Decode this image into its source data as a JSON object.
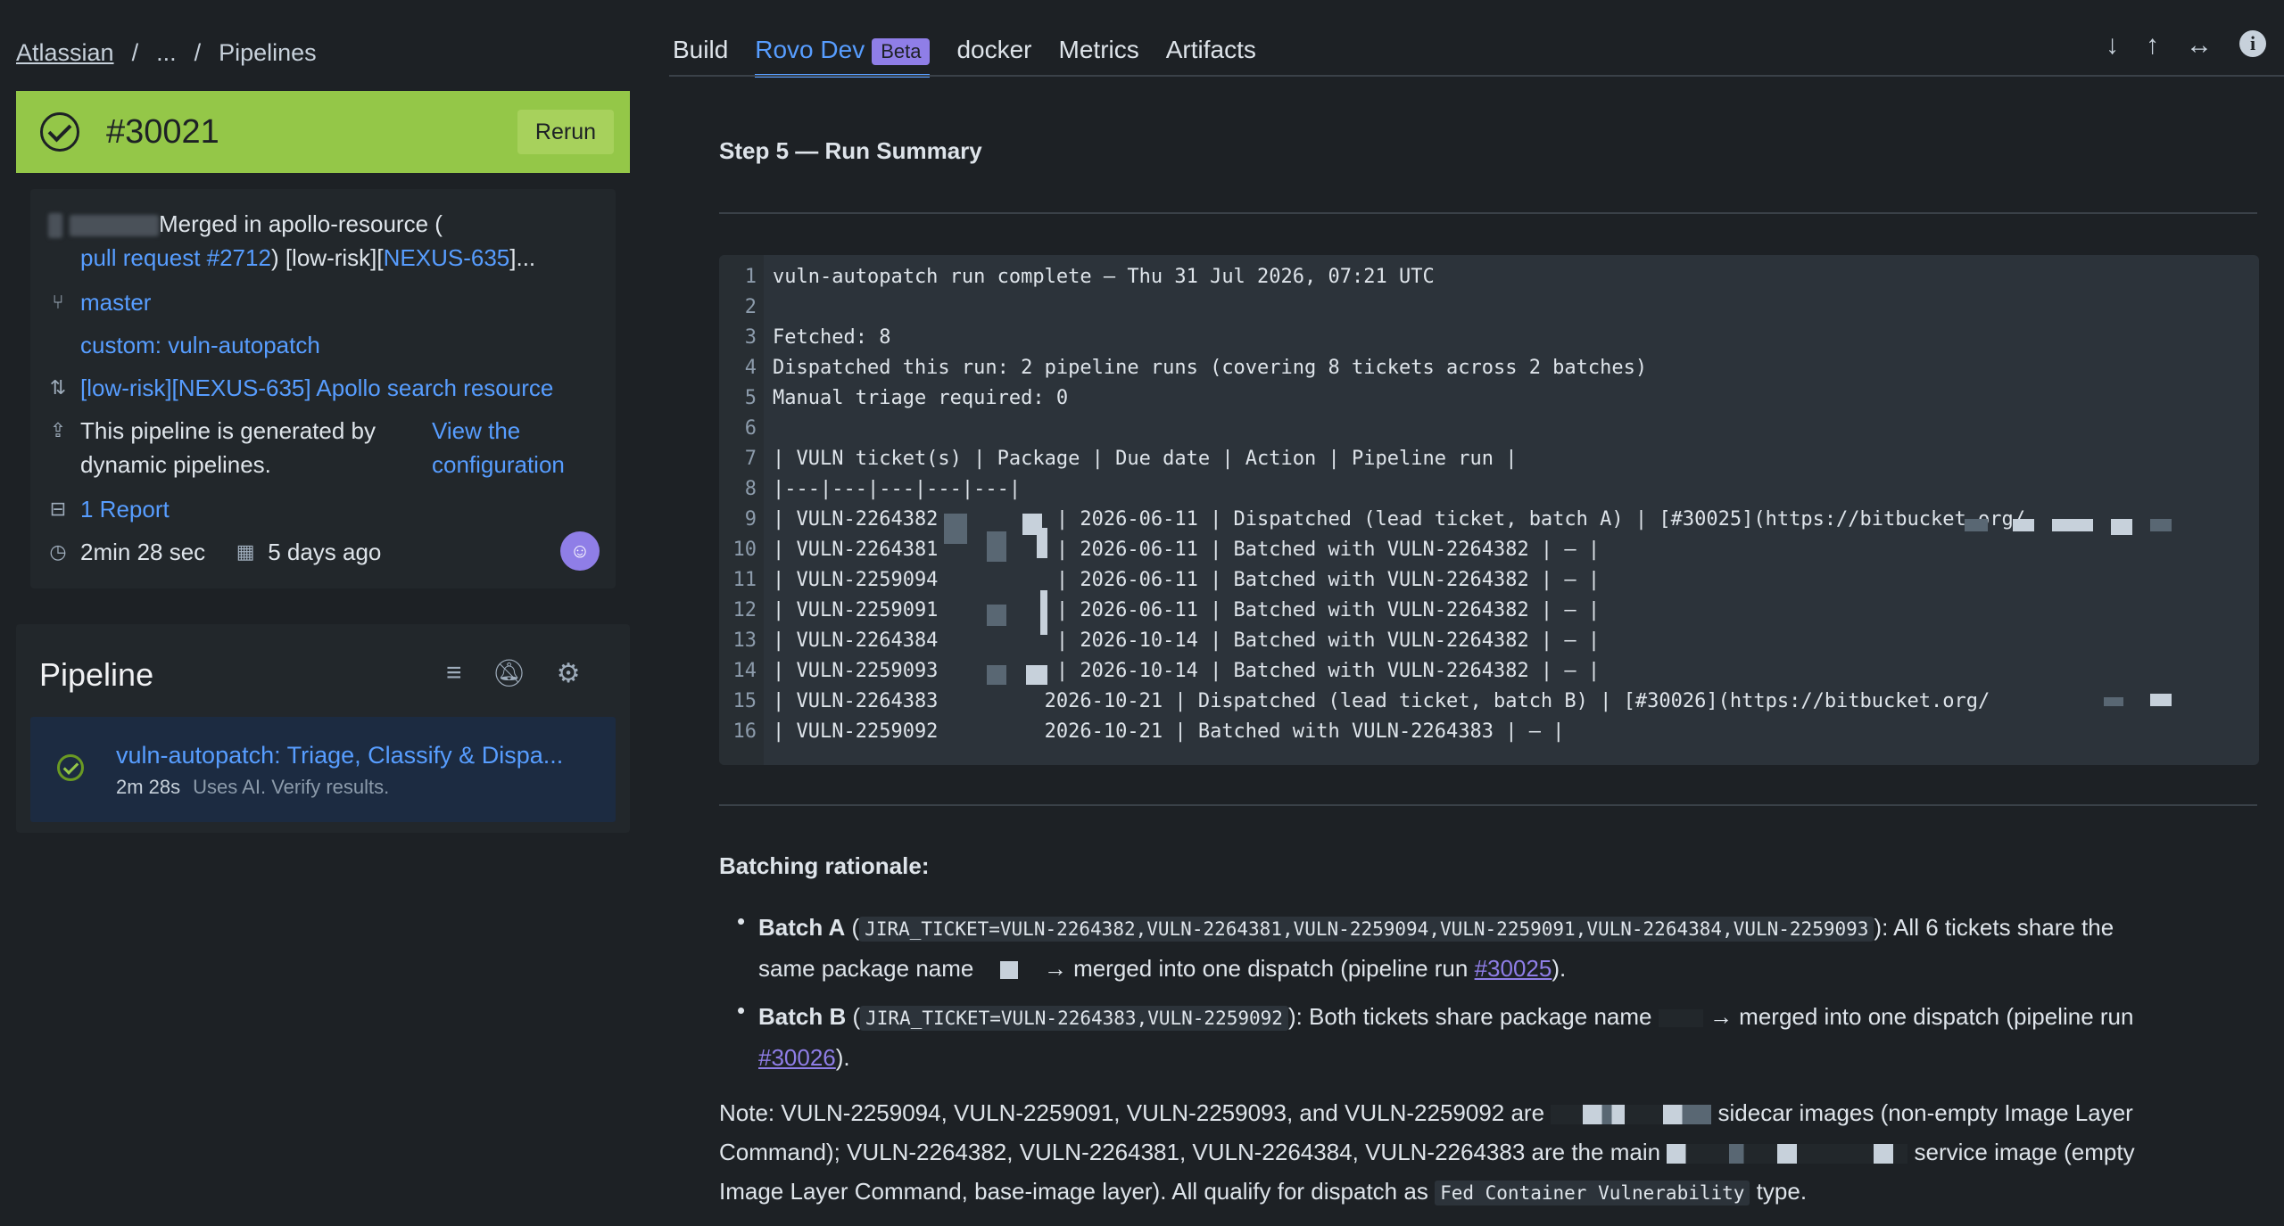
{
  "breadcrumb": [
    "Atlassian",
    "...",
    "Pipelines"
  ],
  "build": {
    "number": "#30021",
    "rerun_label": "Rerun"
  },
  "info": {
    "commit_text": "Merged in apollo-resource (",
    "commit_link": "pull request #2712",
    "commit_rest": ") [low-risk][",
    "commit_ticket": "NEXUS-635",
    "commit_tail": "]...",
    "branch": "master",
    "custom": "custom: vuln-autopatch",
    "pr": "[low-risk][NEXUS-635] Apollo search resource",
    "generated_text": "This pipeline is generated by dynamic pipelines.",
    "view_config": "View the configuration",
    "report": "1 Report",
    "duration": "2min 28 sec",
    "ago": "5 days ago"
  },
  "pipeline": {
    "title": "Pipeline",
    "item_name": "vuln-autopatch: Triage, Classify & Dispa...",
    "item_duration": "2m 28s",
    "item_note": "Uses AI. Verify results."
  },
  "tabs": {
    "build": "Build",
    "rovo": "Rovo Dev",
    "beta": "Beta",
    "docker": "docker",
    "metrics": "Metrics",
    "artifacts": "Artifacts"
  },
  "step_title": "Step 5 — Run Summary",
  "code_lines": [
    "vuln-autopatch run complete — Thu 31 Jul 2026, 07:21 UTC",
    "",
    "Fetched: 8",
    "Dispatched this run: 2 pipeline runs (covering 8 tickets across 2 batches)",
    "Manual triage required: 0",
    "",
    "| VULN ticket(s) | Package | Due date | Action | Pipeline run |",
    "|---|---|---|---|---|",
    "| VULN-2264382          | 2026-06-11 | Dispatched (lead ticket, batch A) | [#30025](https://bitbucket.org/",
    "| VULN-2264381          | 2026-06-11 | Batched with VULN-2264382 | — |",
    "| VULN-2259094          | 2026-06-11 | Batched with VULN-2264382 | — |",
    "| VULN-2259091          | 2026-06-11 | Batched with VULN-2264382 | — |",
    "| VULN-2264384          | 2026-10-14 | Batched with VULN-2264382 | — |",
    "| VULN-2259093          | 2026-10-14 | Batched with VULN-2264382 | — |",
    "| VULN-2264383         2026-10-21 | Dispatched (lead ticket, batch B) | [#30026](https://bitbucket.org/",
    "| VULN-2259092         2026-10-21 | Batched with VULN-2264383 | — |"
  ],
  "rationale": {
    "title": "Batching rationale:",
    "a_label": "Batch A",
    "a_code": "JIRA_TICKET=VULN-2264382,VULN-2264381,VULN-2259094,VULN-2259091,VULN-2264384,VULN-2259093",
    "a_text1": "): All 6 tickets share the",
    "a_text2": "same package name",
    "a_text3": "→ merged into one dispatch (pipeline run",
    "a_link": "#30025",
    "a_end": ").",
    "b_label": "Batch B",
    "b_code": "JIRA_TICKET=VULN-2264383,VULN-2259092",
    "b_text1": "): Both tickets share package name",
    "b_text2": "→ merged into one dispatch (pipeline run",
    "b_link": "#30026",
    "b_end": ").",
    "note1": "Note: VULN-2259094, VULN-2259091, VULN-2259093, and VULN-2259092 are",
    "note2": "sidecar images (non-empty Image Layer",
    "note3": "Command); VULN-2264382, VULN-2264381, VULN-2264384, VULN-2264383 are the main",
    "note4": "service image (empty",
    "note5": "Image Layer Command, base-image layer). All qualify for dispatch as",
    "note_code": "Fed Container Vulnerability",
    "note6": "type."
  },
  "colors": {
    "success": "#94c748",
    "link": "#579dff",
    "beta": "#8f7ee7"
  }
}
